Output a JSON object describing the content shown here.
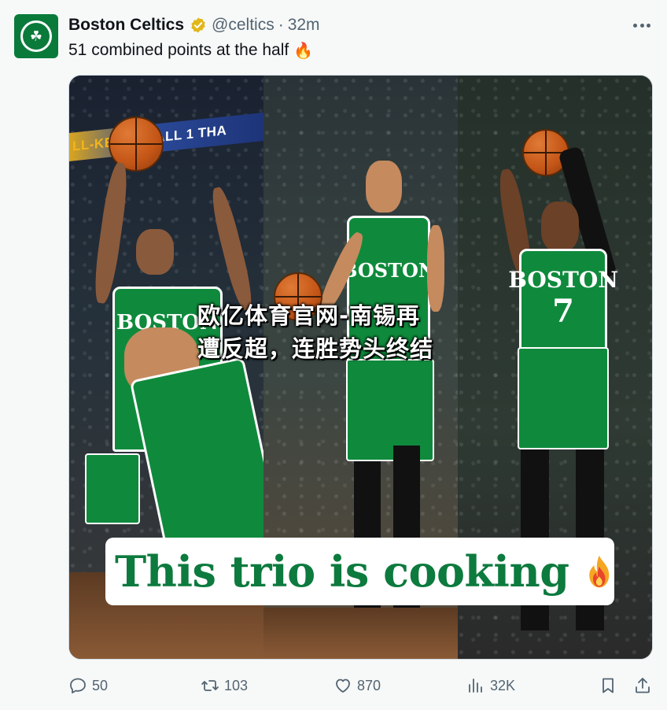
{
  "author": {
    "name": "Boston Celtics",
    "handle": "@celtics",
    "separator": "·",
    "time": "32m",
    "avatar_icon": "celtics-logo"
  },
  "tweet": {
    "text": "51 combined points at the half",
    "text_emoji": "🔥"
  },
  "media": {
    "panel1_banner_left": "LL-KE",
    "panel1_banner_right": "NE CALL 1 THA",
    "panel1_jersey_text": "BOSTON",
    "panel2_jersey_text": "BOSTON",
    "panel3_jersey_text": "BOSTON",
    "panel3_jersey_number": "7",
    "watermark_line1": "欧亿体育官网-南锡再",
    "watermark_line2": "遭反超，连胜势头终结",
    "overlay_text": "This trio is cooking",
    "overlay_emoji": "fire-icon"
  },
  "actions": {
    "replies": "50",
    "retweets": "103",
    "likes": "870",
    "views": "32K"
  },
  "colors": {
    "celtics_green": "#0d7a3e",
    "muted": "#536471",
    "verified_gold": "#e2b719"
  }
}
